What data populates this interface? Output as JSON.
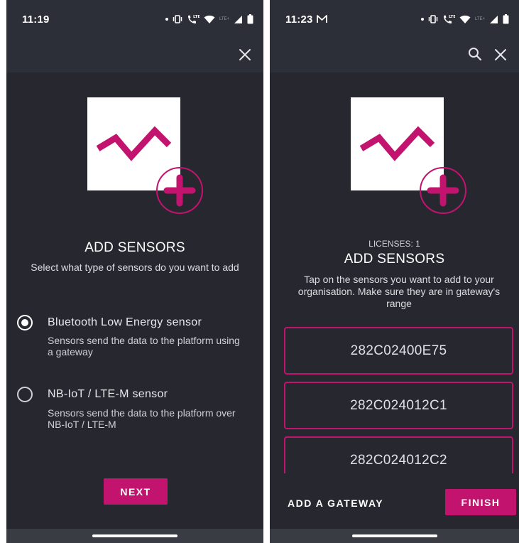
{
  "left_screen": {
    "status_bar": {
      "time": "11:19",
      "network_label": "LTE+"
    },
    "title": "ADD SENSORS",
    "subtitle": "Select what type of sensors do you want to add",
    "options": [
      {
        "title": "Bluetooth Low Energy sensor",
        "description": "Sensors send the data to the platform using a gateway",
        "selected": true
      },
      {
        "title": "NB-IoT / LTE-M sensor",
        "description": "Sensors send the data to the platform over NB-IoT / LTE-M",
        "selected": false
      }
    ],
    "next_label": "NEXT"
  },
  "right_screen": {
    "status_bar": {
      "time": "11:23",
      "network_label": "LTE+"
    },
    "licenses": "LICENSES: 1",
    "title": "ADD SENSORS",
    "subtitle": "Tap on the sensors you want to add to your organisation. Make sure they are in gateway's range",
    "sensors": [
      "282C02400E75",
      "282C024012C1",
      "282C024012C2"
    ],
    "add_gateway_label": "ADD A GATEWAY",
    "finish_label": "FINISH"
  },
  "colors": {
    "accent": "#c2136f",
    "background": "#27272f",
    "toolbar": "#2d2f38"
  },
  "icons": [
    "close-icon",
    "search-icon",
    "mail-icon",
    "vibrate-icon",
    "call-lte-icon",
    "wifi-icon",
    "signal-icon",
    "battery-icon",
    "sensor-chart-icon",
    "add-plus-icon"
  ]
}
